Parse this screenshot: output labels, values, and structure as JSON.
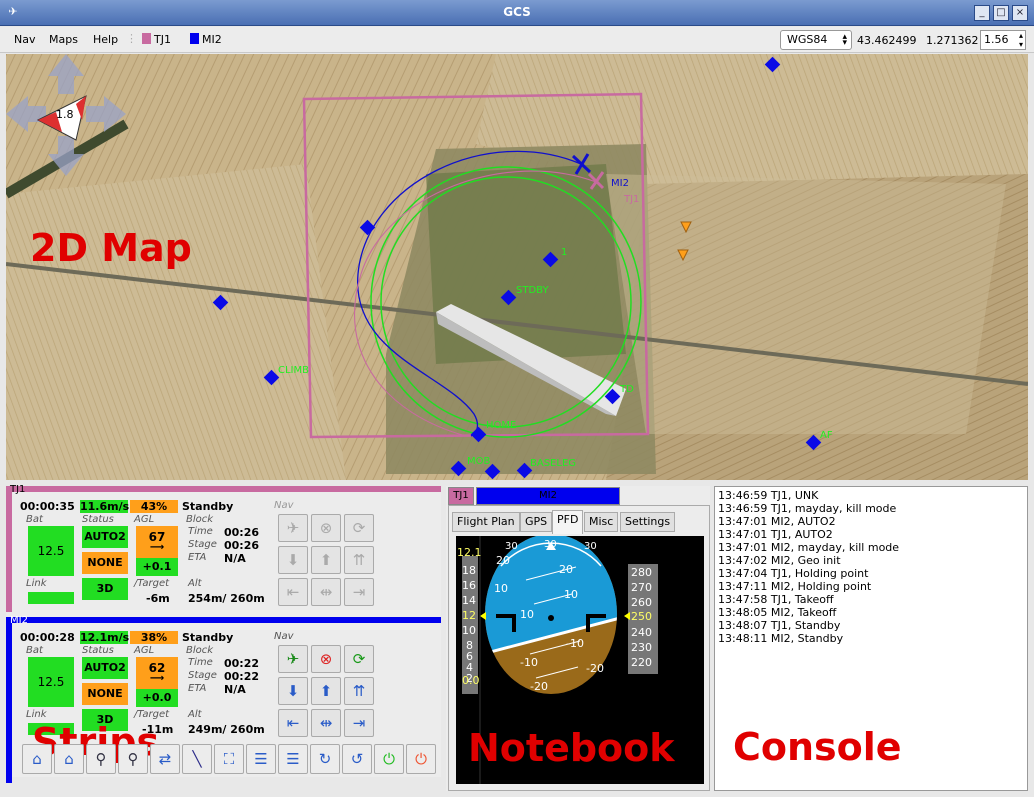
{
  "window": {
    "title": "GCS"
  },
  "menu": {
    "items": [
      "Nav",
      "Maps",
      "Help"
    ]
  },
  "aircraft_selectors": [
    {
      "name": "TJ1",
      "color": "#c86aa0"
    },
    {
      "name": "MI2",
      "color": "#0000ee"
    }
  ],
  "toolbar": {
    "geo_system": "WGS84",
    "latitude": "43.462499",
    "longitude": "1.271362",
    "zoom": "1.56"
  },
  "map": {
    "overlay_label": "2D Map",
    "compass_value": "1.8",
    "waypoints": [
      "1",
      "STDBY",
      "TD",
      "CLIMB",
      "HOME",
      "MOB",
      "BASELEG",
      "AF"
    ],
    "aircraft_labels": [
      "MI2",
      "TJ1"
    ]
  },
  "strips": {
    "overlay_label": "Strips",
    "items": [
      {
        "name": "TJ1",
        "color": "#c86aa0",
        "time": "00:00:35",
        "speed": "11.6m/s",
        "throttle": "43%",
        "block_name": "Standby",
        "bat_label": "Bat",
        "bat": "12.5",
        "status_label": "Status",
        "mode": "AUTO2",
        "gps_mode": "NONE",
        "fix": "3D",
        "agl_label": "AGL",
        "agl": "67",
        "climb": "+0.1",
        "block_label": "Block",
        "time_label": "Time",
        "block_time": "00:26",
        "stage_label": "Stage",
        "stage_time": "00:26",
        "eta_label": "ETA",
        "eta": "N/A",
        "link_label": "Link",
        "target_label": "/Target",
        "target": "-6m",
        "alt_label": "Alt",
        "alt": "254m/ 260m",
        "nav_label": "Nav"
      },
      {
        "name": "MI2",
        "color": "#0000ee",
        "time": "00:00:28",
        "speed": "12.1m/s",
        "throttle": "38%",
        "block_name": "Standby",
        "bat_label": "Bat",
        "bat": "12.5",
        "status_label": "Status",
        "mode": "AUTO2",
        "gps_mode": "NONE",
        "fix": "3D",
        "agl_label": "AGL",
        "agl": "62",
        "climb": "+0.0",
        "block_label": "Block",
        "time_label": "Time",
        "block_time": "00:22",
        "stage_label": "Stage",
        "stage_time": "00:22",
        "eta_label": "ETA",
        "eta": "N/A",
        "link_label": "Link",
        "target_label": "/Target",
        "target": "-11m",
        "alt_label": "Alt",
        "alt": "249m/ 260m",
        "nav_label": "Nav"
      }
    ]
  },
  "notebook": {
    "overlay_label": "Notebook",
    "ac_tabs": [
      "TJ1",
      "MI2"
    ],
    "tabs": [
      "Flight Plan",
      "GPS",
      "PFD",
      "Misc",
      "Settings"
    ],
    "active_tab": "PFD",
    "pfd": {
      "speed_ticks": [
        "12.1",
        "18",
        "16",
        "14",
        "12",
        "10",
        "8",
        "6",
        "4",
        "2",
        "0.0"
      ],
      "alt_ticks": [
        "280",
        "270",
        "260",
        "250",
        "240",
        "230",
        "220"
      ],
      "alt_current": "250",
      "roll_ticks": [
        "30",
        "30",
        "30"
      ],
      "pitch_up": [
        "20",
        "10",
        "20",
        "10"
      ],
      "pitch_down": [
        "-10",
        "-20",
        "-10",
        "-20"
      ]
    }
  },
  "console": {
    "overlay_label": "Console",
    "lines": [
      "13:46:59 TJ1, UNK",
      "13:46:59 TJ1, mayday, kill mode",
      "13:47:01 MI2, AUTO2",
      "13:47:01 TJ1, AUTO2",
      "13:47:01 MI2, mayday, kill mode",
      "13:47:02 MI2, Geo init",
      "13:47:04 TJ1, Holding point",
      "13:47:11 MI2, Holding point",
      "13:47:58 TJ1, Takeoff",
      "13:48:05 MI2, Takeoff",
      "13:48:07 TJ1, Standby",
      "13:48:11 MI2, Standby"
    ]
  }
}
